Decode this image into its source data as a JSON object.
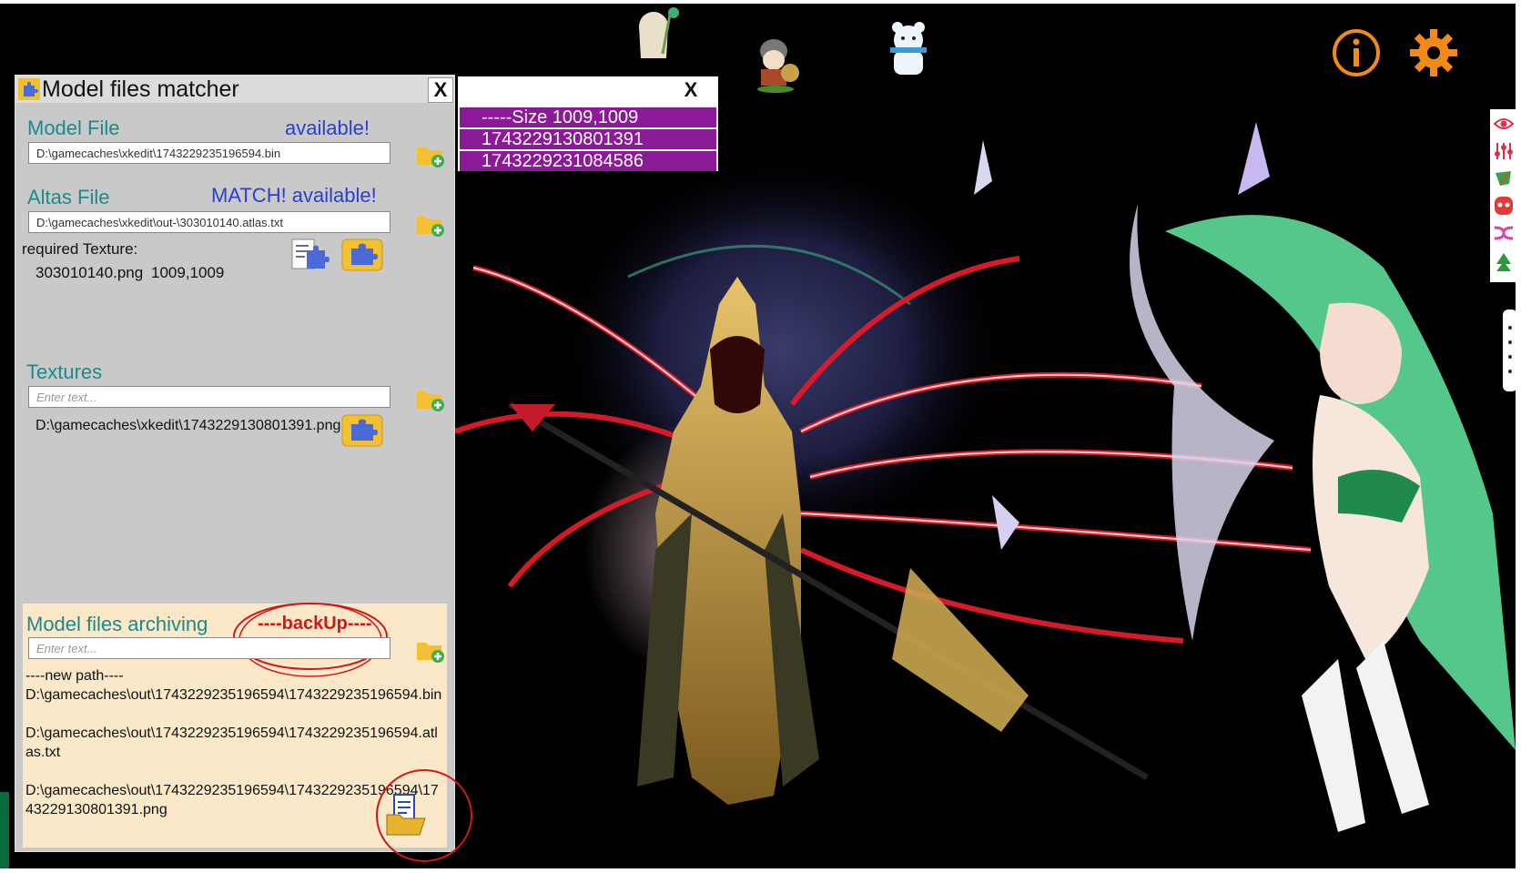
{
  "panel": {
    "title": "Model files matcher",
    "close_label": "X",
    "model_file": {
      "label": "Model File",
      "status": "available!",
      "value": "D:\\gamecaches\\xkedit\\1743229235196594.bin"
    },
    "atlas_file": {
      "label": "Altas File",
      "status": "MATCH! available!",
      "value": "D:\\gamecaches\\xkedit\\out-\\303010140.atlas.txt"
    },
    "required_texture": {
      "label": "required Texture:",
      "name": "303010140.png",
      "size": "1009,1009"
    },
    "textures": {
      "label": "Textures",
      "placeholder": "Enter text...",
      "path": "D:\\gamecaches\\xkedit\\1743229130801391.png"
    },
    "archiving": {
      "label": "Model files archiving",
      "backup_label": "----backUp----",
      "placeholder": "Enter text...",
      "new_path_header": "----new path----",
      "path_bin": "D:\\gamecaches\\out\\1743229235196594\\1743229235196594.bin",
      "path_atlas": "D:\\gamecaches\\out\\1743229235196594\\1743229235196594.atlas.txt",
      "path_png": "D:\\gamecaches\\out\\1743229235196594\\1743229235196594\\1743229130801391.png"
    }
  },
  "popup": {
    "close_label": "X",
    "rows": [
      "-----Size 1009,1009",
      "1743229130801391",
      "1743229231084586"
    ]
  },
  "colors": {
    "accent_orange": "#f28a1a",
    "label_teal": "#1b8a8a",
    "status_blue": "#2a3fd1",
    "popup_purple": "#8a1a95",
    "annotation_red": "#d01818"
  },
  "icons": [
    "info-icon",
    "settings-gear-icon",
    "eye-icon",
    "sliders-icon",
    "leaf-icon",
    "face-icon",
    "shuffle-icon",
    "tree-icon",
    "folder-add-icon",
    "puzzle-icon",
    "open-folder-document-icon"
  ]
}
